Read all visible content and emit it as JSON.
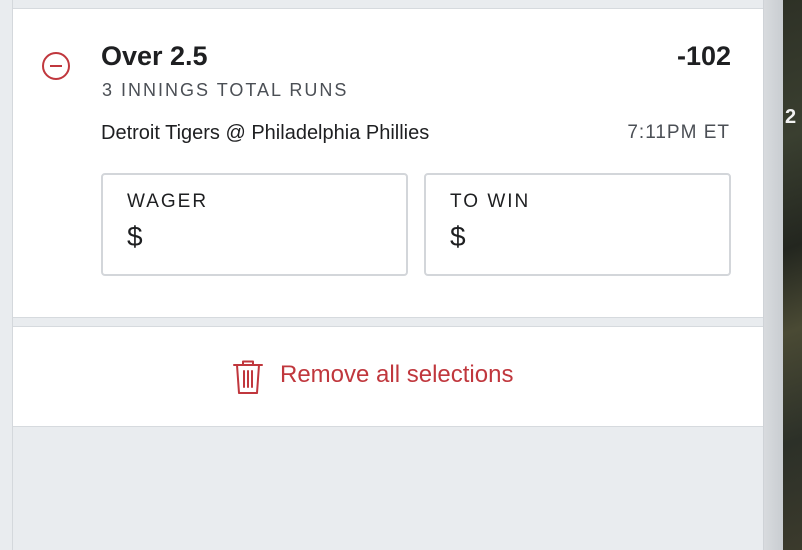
{
  "bet": {
    "selection": "Over 2.5",
    "odds": "-102",
    "market": "3 INNINGS TOTAL RUNS",
    "matchup": "Detroit Tigers @ Philadelphia Phillies",
    "time": "7:11PM ET"
  },
  "wager": {
    "label": "WAGER",
    "value": "$"
  },
  "to_win": {
    "label": "TO WIN",
    "value": "$"
  },
  "actions": {
    "remove_all_label": "Remove all selections"
  },
  "backdrop": {
    "partial_text": "2"
  },
  "colors": {
    "accent_red": "#c0373d",
    "text_dark": "#1e1f21",
    "panel_bg": "#e9ecef"
  },
  "icons": {
    "remove_selection": "minus-circle-icon",
    "remove_all": "trash-icon"
  }
}
